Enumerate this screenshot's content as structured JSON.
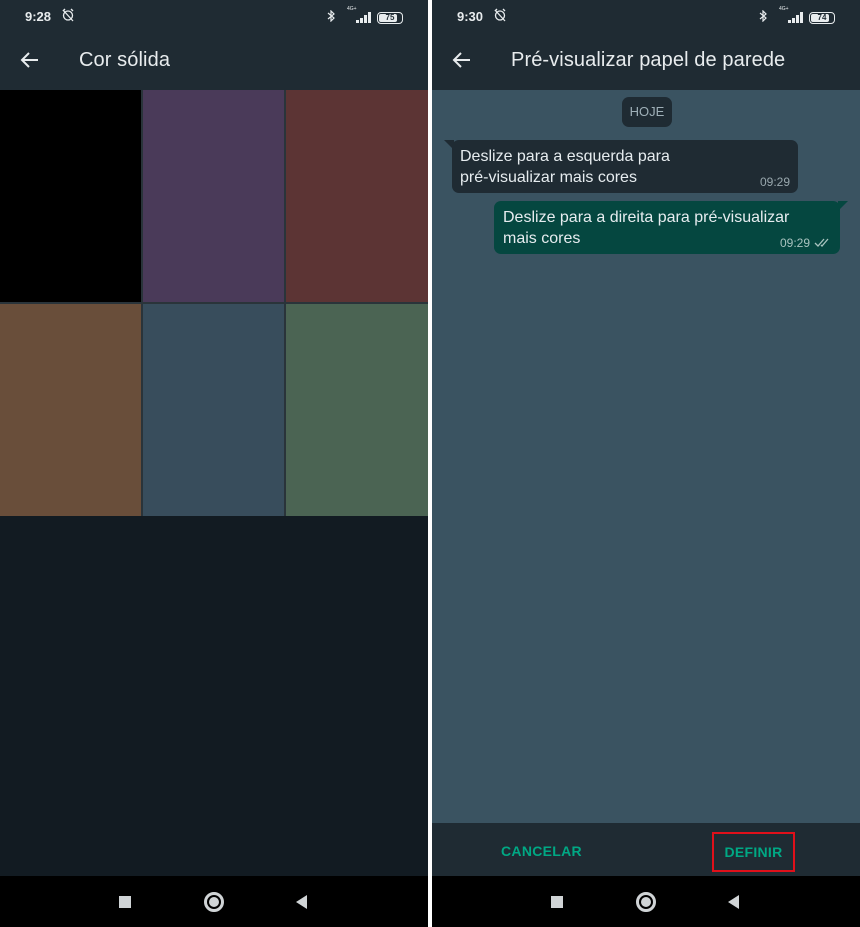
{
  "left_screen": {
    "status_bar": {
      "time": "9:28",
      "network": "4G+",
      "battery": "75"
    },
    "app_bar": {
      "title": "Cor sólida"
    },
    "swatches": [
      {
        "color": "#000000"
      },
      {
        "color": "#4a3a59"
      },
      {
        "color": "#5c3434"
      },
      {
        "color": "#694e3a"
      },
      {
        "color": "#384d5c"
      },
      {
        "color": "#4b6453"
      }
    ]
  },
  "right_screen": {
    "status_bar": {
      "time": "9:30",
      "network": "4G+",
      "battery": "74"
    },
    "app_bar": {
      "title": "Pré-visualizar papel de parede"
    },
    "wallpaper_color": "#3a5361",
    "date_chip": "HOJE",
    "messages": [
      {
        "direction": "incoming",
        "text": "Deslize para a esquerda para\npré-visualizar mais cores",
        "time": "09:29"
      },
      {
        "direction": "outgoing",
        "text": "Deslize para a direita para pré-visualizar\nmais cores",
        "time": "09:29"
      }
    ],
    "actions": {
      "cancel": "CANCELAR",
      "set": "DEFINIR"
    }
  },
  "colors": {
    "accent": "#00a884",
    "highlight": "#e0101a",
    "appbar": "#1f2b33",
    "outgoing_bubble": "#054740"
  }
}
